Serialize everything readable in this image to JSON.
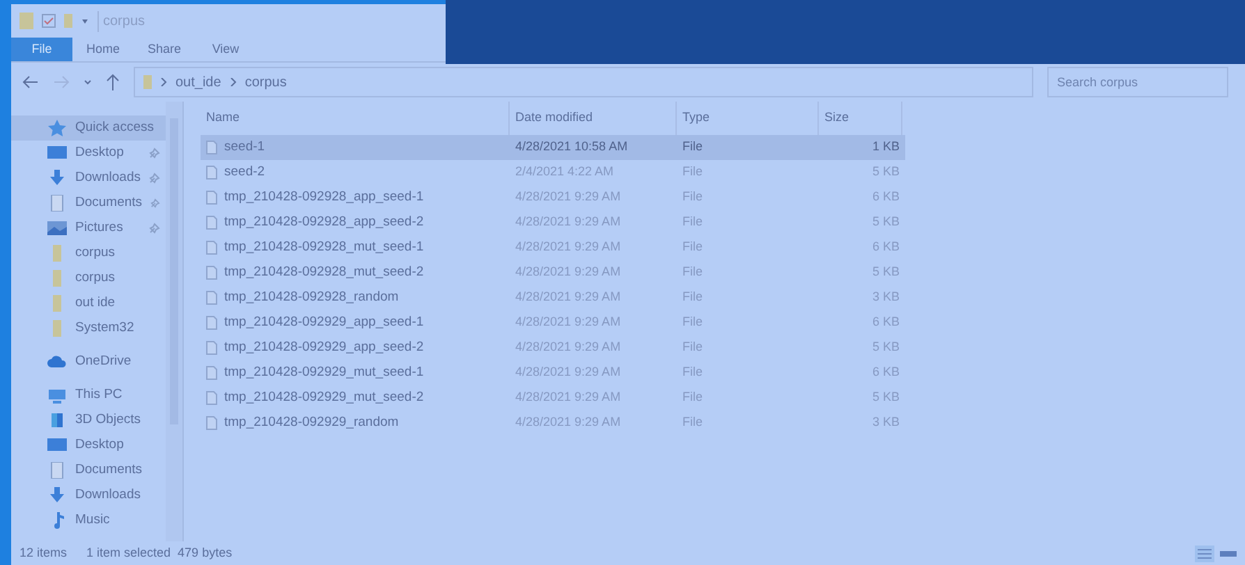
{
  "window": {
    "title": "corpus"
  },
  "ribbon_tabs": [
    {
      "label": "File",
      "selected": true
    },
    {
      "label": "Home",
      "selected": false
    },
    {
      "label": "Share",
      "selected": false
    },
    {
      "label": "View",
      "selected": false
    }
  ],
  "address": {
    "crumbs": [
      "out_ide",
      "corpus"
    ]
  },
  "search": {
    "placeholder": "Search corpus"
  },
  "sidebar": {
    "items": [
      {
        "label": "Quick access",
        "kind": "star",
        "selected": true,
        "pinned": false,
        "children": [
          {
            "label": "Desktop",
            "kind": "desktop",
            "selected": false,
            "pinned": true
          },
          {
            "label": "Downloads",
            "kind": "download",
            "selected": false,
            "pinned": true
          },
          {
            "label": "Documents",
            "kind": "document",
            "selected": false,
            "pinned": true
          },
          {
            "label": "Pictures",
            "kind": "pictures",
            "selected": false,
            "pinned": true
          },
          {
            "label": "corpus",
            "kind": "folder",
            "selected": false,
            "pinned": false
          },
          {
            "label": "corpus",
            "kind": "folder",
            "selected": false,
            "pinned": false
          },
          {
            "label": "out ide",
            "kind": "folder",
            "selected": false,
            "pinned": false
          },
          {
            "label": "System32",
            "kind": "folder",
            "selected": false,
            "pinned": false
          }
        ]
      },
      {
        "label": "OneDrive",
        "kind": "cloud",
        "selected": false,
        "pinned": false
      },
      {
        "label": "This PC",
        "kind": "pc",
        "selected": false,
        "pinned": false,
        "children": [
          {
            "label": "3D Objects",
            "kind": "cube",
            "selected": false,
            "pinned": false
          },
          {
            "label": "Desktop",
            "kind": "desktop",
            "selected": false,
            "pinned": false
          },
          {
            "label": "Documents",
            "kind": "document",
            "selected": false,
            "pinned": false
          },
          {
            "label": "Downloads",
            "kind": "download",
            "selected": false,
            "pinned": false
          },
          {
            "label": "Music",
            "kind": "music",
            "selected": false,
            "pinned": false
          }
        ]
      }
    ]
  },
  "table": {
    "columns": [
      "Name",
      "Date modified",
      "Type",
      "Size"
    ],
    "rows": [
      {
        "name": "seed-1",
        "date": "4/28/2021 10:58 AM",
        "type": "File",
        "size": "1 KB",
        "selected": true
      },
      {
        "name": "seed-2",
        "date": "2/4/2021 4:22 AM",
        "type": "File",
        "size": "5 KB",
        "selected": false
      },
      {
        "name": "tmp_210428-092928_app_seed-1",
        "date": "4/28/2021 9:29 AM",
        "type": "File",
        "size": "6 KB",
        "selected": false
      },
      {
        "name": "tmp_210428-092928_app_seed-2",
        "date": "4/28/2021 9:29 AM",
        "type": "File",
        "size": "5 KB",
        "selected": false
      },
      {
        "name": "tmp_210428-092928_mut_seed-1",
        "date": "4/28/2021 9:29 AM",
        "type": "File",
        "size": "6 KB",
        "selected": false
      },
      {
        "name": "tmp_210428-092928_mut_seed-2",
        "date": "4/28/2021 9:29 AM",
        "type": "File",
        "size": "5 KB",
        "selected": false
      },
      {
        "name": "tmp_210428-092928_random",
        "date": "4/28/2021 9:29 AM",
        "type": "File",
        "size": "3 KB",
        "selected": false
      },
      {
        "name": "tmp_210428-092929_app_seed-1",
        "date": "4/28/2021 9:29 AM",
        "type": "File",
        "size": "6 KB",
        "selected": false
      },
      {
        "name": "tmp_210428-092929_app_seed-2",
        "date": "4/28/2021 9:29 AM",
        "type": "File",
        "size": "5 KB",
        "selected": false
      },
      {
        "name": "tmp_210428-092929_mut_seed-1",
        "date": "4/28/2021 9:29 AM",
        "type": "File",
        "size": "6 KB",
        "selected": false
      },
      {
        "name": "tmp_210428-092929_mut_seed-2",
        "date": "4/28/2021 9:29 AM",
        "type": "File",
        "size": "5 KB",
        "selected": false
      },
      {
        "name": "tmp_210428-092929_random",
        "date": "4/28/2021 9:29 AM",
        "type": "File",
        "size": "3 KB",
        "selected": false
      }
    ]
  },
  "status_bar": {
    "count": "12 items",
    "selection": "1 item selected  479 bytes"
  }
}
